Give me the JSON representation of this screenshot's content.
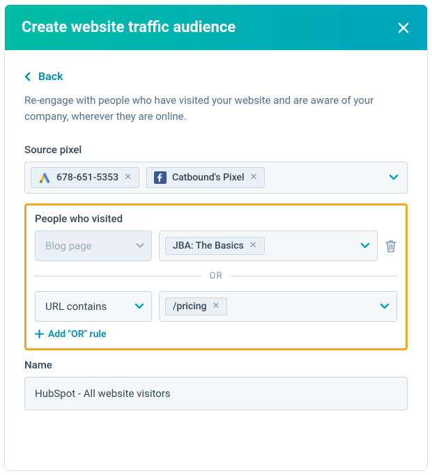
{
  "header": {
    "title": "Create website traffic audience"
  },
  "back_label": "Back",
  "description": "Re-engage with people who have visited your website and are aware of your company, wherever they are online.",
  "source_pixel": {
    "label": "Source pixel",
    "tags": [
      {
        "icon": "google-ads-icon",
        "label": "678-651-5353"
      },
      {
        "icon": "facebook-icon",
        "label": "Catbound's Pixel"
      }
    ]
  },
  "visited": {
    "label": "People who visited",
    "rules": [
      {
        "type_label": "Blog page",
        "disabled": true,
        "chips": [
          "JBA: The Basics"
        ],
        "deletable": true
      },
      {
        "type_label": "URL contains",
        "disabled": false,
        "chips": [
          "/pricing"
        ],
        "deletable": false
      }
    ],
    "or_label": "OR",
    "add_or_label": "Add \"OR\" rule"
  },
  "name": {
    "label": "Name",
    "value": "HubSpot - All website visitors"
  }
}
